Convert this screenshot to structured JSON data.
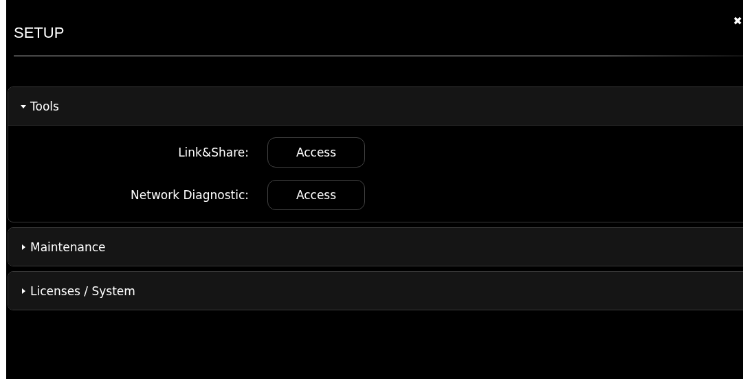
{
  "window": {
    "title": "SETUP",
    "close": "✖"
  },
  "sections": [
    {
      "title": "Tools",
      "expanded": true,
      "rows": [
        {
          "label": "Link&Share:",
          "button": "Access"
        },
        {
          "label": "Network Diagnostic:",
          "button": "Access"
        }
      ]
    },
    {
      "title": "Maintenance",
      "expanded": false
    },
    {
      "title": "Licenses / System",
      "expanded": false
    }
  ]
}
